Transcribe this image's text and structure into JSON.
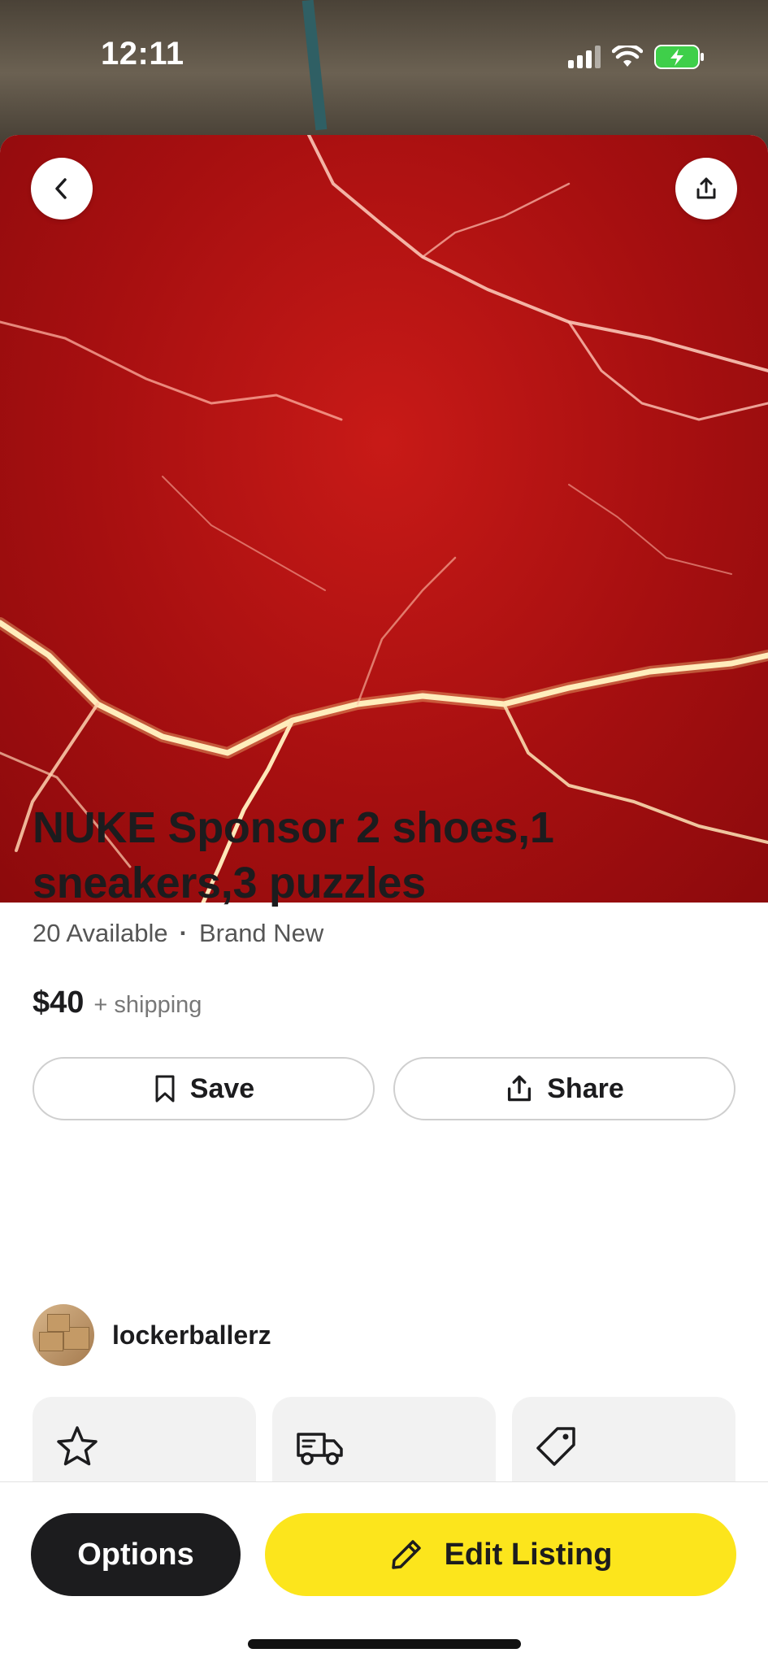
{
  "status": {
    "time": "12:11"
  },
  "listing": {
    "title": "NUKE Sponsor 2 shoes,1 sneakers,3 puzzles",
    "availability": "20 Available",
    "separator": "·",
    "condition": "Brand New",
    "price": "$40",
    "shipping": "+ shipping"
  },
  "actions": {
    "save_label": "Save",
    "share_label": "Share"
  },
  "seller": {
    "username": "lockerballerz"
  },
  "info_cards": [
    {
      "icon": "star-icon"
    },
    {
      "icon": "truck-icon"
    },
    {
      "icon": "tag-icon"
    }
  ],
  "bottom_bar": {
    "options_label": "Options",
    "edit_label": "Edit Listing"
  },
  "colors": {
    "accent_yellow": "#fce51c",
    "dark_button": "#1c1c1e",
    "hero_red": "#b01414"
  }
}
